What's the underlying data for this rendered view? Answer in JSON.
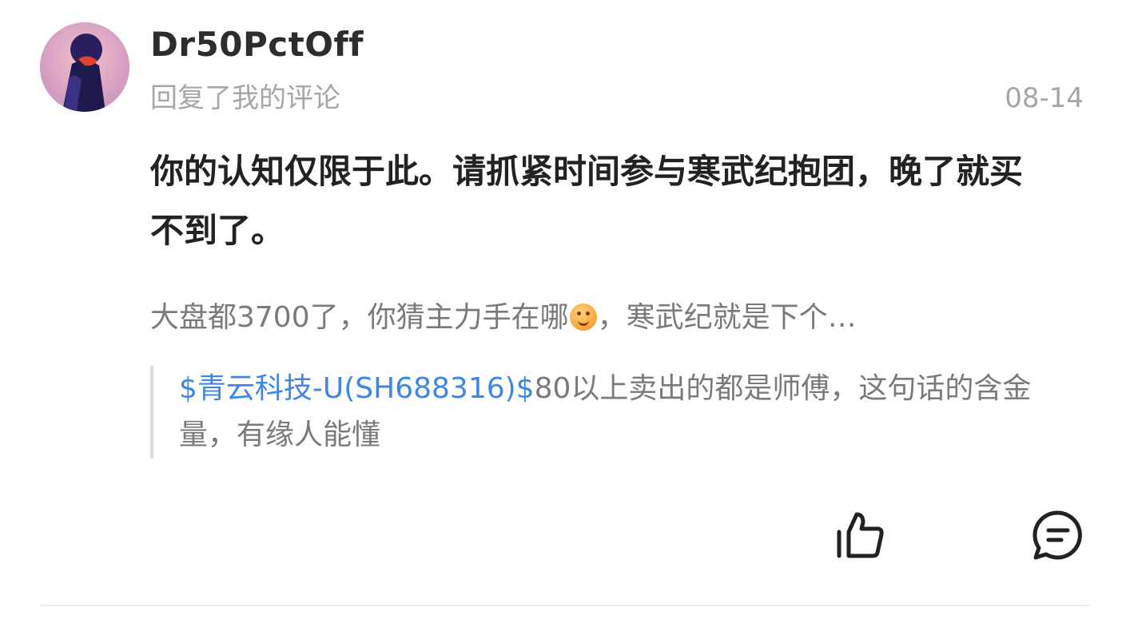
{
  "comment": {
    "username": "Dr50PctOff",
    "action_text": "回复了我的评论",
    "date": "08-14",
    "reply_text": "你的认知仅限于此。请抓紧时间参与寒武纪抱团，晚了就买不到了。",
    "quoted_comment": {
      "text_before_emoji": "大盘都3700了，你猜主力手在哪",
      "emoji_name": "smirk-emoji",
      "text_after_emoji": "，寒武纪就是下个…"
    },
    "original_post": {
      "stock_link": "$青云科技-U(SH688316)$",
      "text": "80以上卖出的都是师傅，这句话的含金量，有缘人能懂"
    }
  },
  "icons": {
    "like": "thumbs-up-icon",
    "reply": "comment-bubble-icon"
  },
  "colors": {
    "link": "#3d86e6",
    "muted": "#a6a6a6",
    "body": "#222222"
  }
}
